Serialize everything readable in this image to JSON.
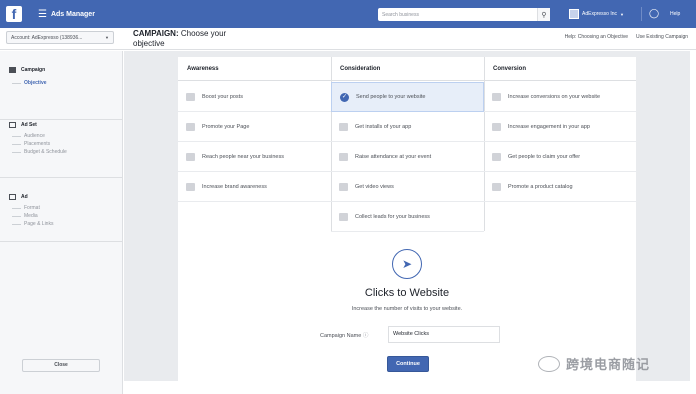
{
  "topbar": {
    "logo": "f",
    "app_title": "Ads Manager",
    "search_placeholder": "Search business",
    "account_name": "AdExpresso Inc",
    "help": "Help",
    "icons": [
      "menu-icon",
      "search-icon",
      "globe-icon"
    ]
  },
  "subbar": {
    "account_select": "Account: AdExpresso (138936...",
    "campaign_label": "CAMPAIGN:",
    "campaign_title": "Choose your objective",
    "links": [
      "Help: Choosing an Objective",
      "Use Existing Campaign"
    ]
  },
  "sidebar": {
    "campaign": {
      "label": "Campaign",
      "items": [
        "Objective"
      ]
    },
    "adset": {
      "label": "Ad Set",
      "items": [
        "Audience",
        "Placements",
        "Budget & Schedule"
      ]
    },
    "ad": {
      "label": "Ad",
      "items": [
        "Format",
        "Media",
        "Page & Links"
      ]
    },
    "close": "Close"
  },
  "objectives": {
    "awareness": {
      "header": "Awareness",
      "items": [
        "Boost your posts",
        "Promote your Page",
        "Reach people near your business",
        "Increase brand awareness"
      ]
    },
    "consideration": {
      "header": "Consideration",
      "items": [
        "Send people to your website",
        "Get installs of your app",
        "Raise attendance at your event",
        "Get video views",
        "Collect leads for your business"
      ]
    },
    "conversion": {
      "header": "Conversion",
      "items": [
        "Increase conversions on your website",
        "Increase engagement in your app",
        "Get people to claim your offer",
        "Promote a product catalog"
      ]
    }
  },
  "selected": {
    "title": "Clicks to Website",
    "description": "Increase the number of visits to your website.",
    "campaign_name_label": "Campaign Name",
    "campaign_name_value": "Website Clicks",
    "continue": "Continue"
  },
  "watermark": "跨境电商随记",
  "colors": {
    "brand": "#4267b2",
    "selected_bg": "#e7eef9",
    "page_bg": "#e9ebee"
  }
}
